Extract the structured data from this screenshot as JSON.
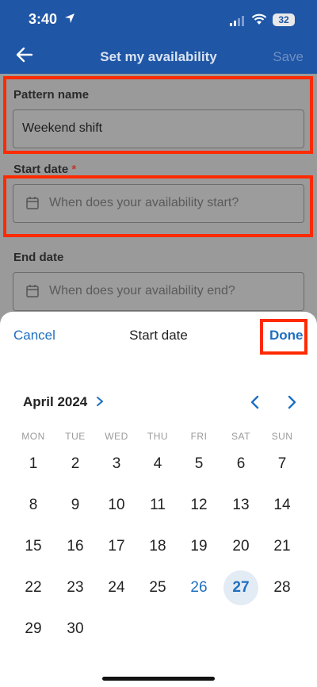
{
  "status": {
    "time": "3:40",
    "battery": "32"
  },
  "nav": {
    "title": "Set my availability",
    "save_label": "Save"
  },
  "form": {
    "pattern_label": "Pattern name",
    "pattern_value": "Weekend shift",
    "start_label": "Start date",
    "start_required": "*",
    "start_placeholder": "When does your availability start?",
    "end_label": "End date",
    "end_placeholder": "When does your availability end?"
  },
  "sheet": {
    "cancel_label": "Cancel",
    "title": "Start date",
    "done_label": "Done",
    "month": "April 2024",
    "weekdays": [
      "MON",
      "TUE",
      "WED",
      "THU",
      "FRI",
      "SAT",
      "SUN"
    ],
    "days": [
      "1",
      "2",
      "3",
      "4",
      "5",
      "6",
      "7",
      "8",
      "9",
      "10",
      "11",
      "12",
      "13",
      "14",
      "15",
      "16",
      "17",
      "18",
      "19",
      "20",
      "21",
      "22",
      "23",
      "24",
      "25",
      "26",
      "27",
      "28",
      "29",
      "30"
    ],
    "today": "26",
    "selected": "27"
  },
  "colors": {
    "accent": "#1f6fc0",
    "header": "#1f56a6",
    "highlight": "#ff2a00"
  }
}
